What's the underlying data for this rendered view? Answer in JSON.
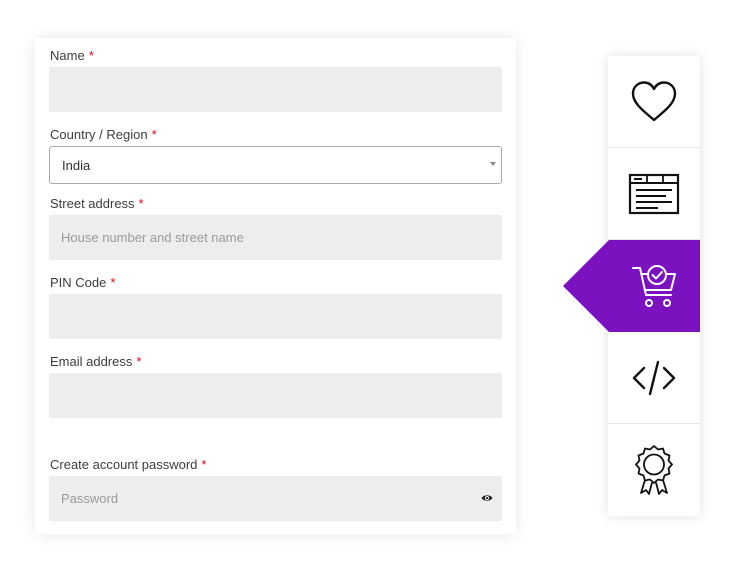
{
  "form": {
    "required_mark": "*",
    "name": {
      "label": "Name",
      "value": ""
    },
    "country": {
      "label": "Country / Region",
      "value": "India"
    },
    "street": {
      "label": "Street address",
      "placeholder": "House number and street name"
    },
    "pin": {
      "label": "PIN Code",
      "value": ""
    },
    "email": {
      "label": "Email address",
      "value": ""
    },
    "password": {
      "label": "Create account password",
      "placeholder": "Password"
    }
  },
  "sidebar": {
    "active_index": 2,
    "accent_color": "#7b12c0",
    "items": [
      {
        "icon": "heart-icon"
      },
      {
        "icon": "browser-window-icon"
      },
      {
        "icon": "cart-check-icon"
      },
      {
        "icon": "code-icon"
      },
      {
        "icon": "award-badge-icon"
      }
    ]
  }
}
